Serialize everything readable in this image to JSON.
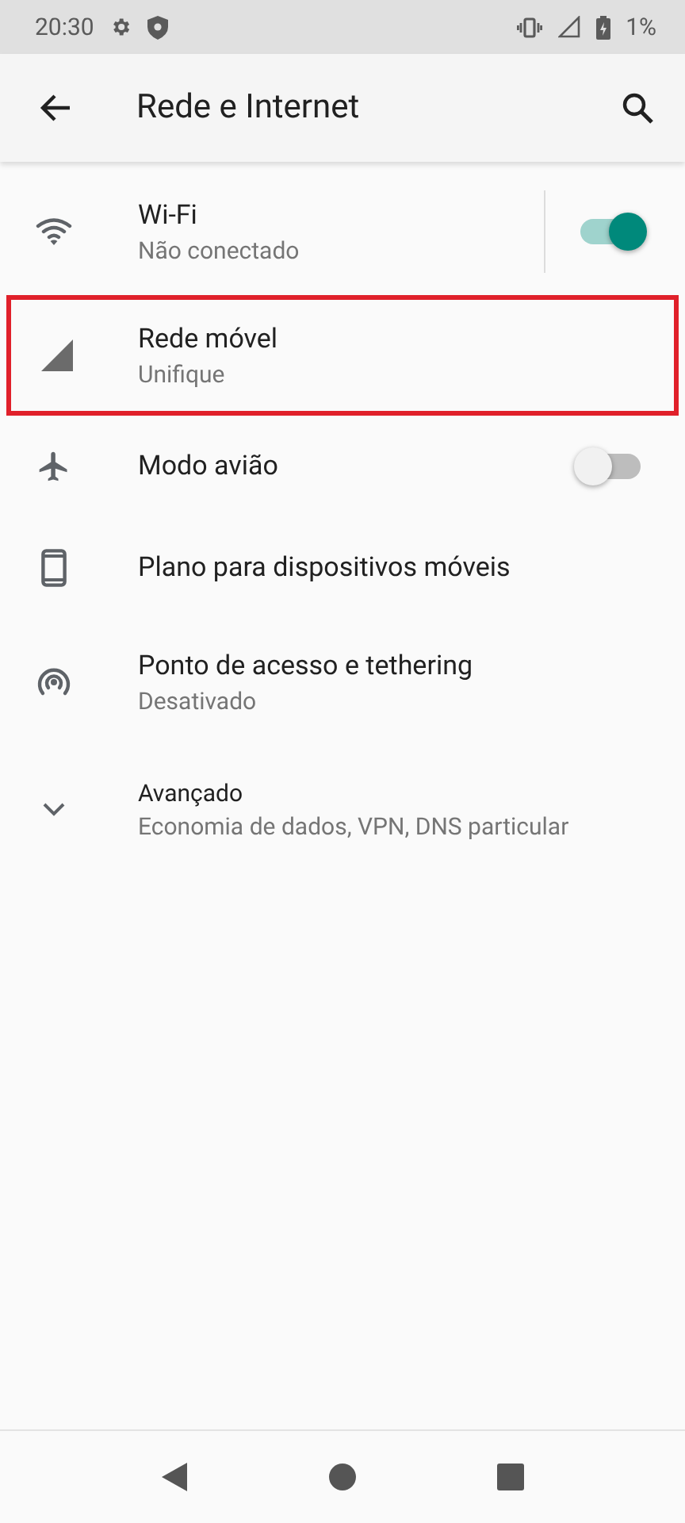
{
  "status_bar": {
    "time": "20:30",
    "battery": "1%"
  },
  "app_bar": {
    "title": "Rede e Internet"
  },
  "rows": [
    {
      "kind": "wifi",
      "title": "Wi-Fi",
      "summary": "Não conectado",
      "toggle": {
        "on": true
      },
      "highlighted": false
    },
    {
      "kind": "mobile",
      "title": "Rede móvel",
      "summary": "Unifique",
      "highlighted": true
    },
    {
      "kind": "airplane",
      "title": "Modo avião",
      "toggle": {
        "on": false
      },
      "highlighted": false
    },
    {
      "kind": "plan",
      "title": "Plano para dispositivos móveis",
      "highlighted": false
    },
    {
      "kind": "hotspot",
      "title": "Ponto de acesso e tethering",
      "summary": "Desativado",
      "highlighted": false
    },
    {
      "kind": "expander",
      "title": "Avançado",
      "summary": "Economia de dados, VPN, DNS particular",
      "highlighted": false
    }
  ]
}
